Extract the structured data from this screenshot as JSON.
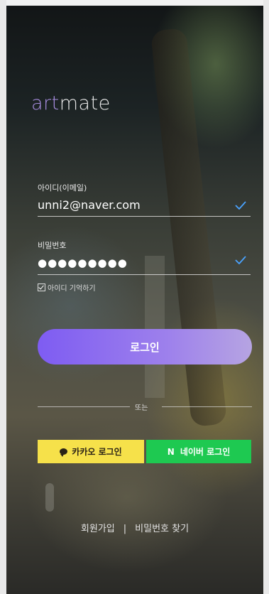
{
  "brand": {
    "part1": "art",
    "part2": "mate",
    "accent_color": "#a88de0"
  },
  "form": {
    "id_label": "아이디(이메일)",
    "id_value": "unni2@naver.com",
    "password_label": "비밀번호",
    "password_value": "●●●●●●●●●",
    "remember_label": "아이디 기억하기",
    "check_color": "#4aa3ff",
    "login_label": "로그인"
  },
  "divider": {
    "text": "또는"
  },
  "social": {
    "kakao_label": "카카오 로그인",
    "kakao_color": "#f6e14a",
    "naver_mark": "N",
    "naver_label": "네이버 로그인",
    "naver_color": "#1ec951"
  },
  "footer": {
    "signup": "회원가입",
    "separator": "|",
    "find_password": "비밀번호 찾기"
  }
}
